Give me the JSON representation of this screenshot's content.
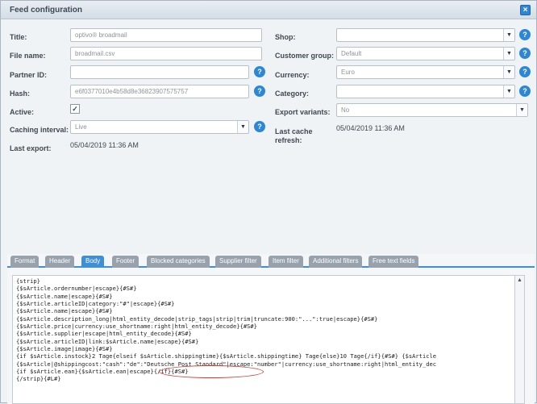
{
  "window": {
    "title": "Feed configuration",
    "close_icon": "close-icon"
  },
  "left": {
    "title": {
      "label": "Title:",
      "value": "optivo® broadmail"
    },
    "file_name": {
      "label": "File name:",
      "value": "broadmail.csv"
    },
    "partner_id": {
      "label": "Partner ID:",
      "value": ""
    },
    "hash": {
      "label": "Hash:",
      "value": "e6f0377010e4b58d8e36823907575757"
    },
    "active": {
      "label": "Active:",
      "checked": "✓"
    },
    "caching": {
      "label": "Caching interval:",
      "value": "Live"
    },
    "last_export": {
      "label": "Last export:",
      "value": "05/04/2019 11:36 AM"
    }
  },
  "right": {
    "shop": {
      "label": "Shop:",
      "value": ""
    },
    "customer_group": {
      "label": "Customer group:",
      "value": "Default"
    },
    "currency": {
      "label": "Currency:",
      "value": "Euro"
    },
    "category": {
      "label": "Category:",
      "value": ""
    },
    "export_variants": {
      "label": "Export variants:",
      "value": "No"
    },
    "last_cache": {
      "label": "Last cache refresh:",
      "value": "05/04/2019 11:36 AM"
    }
  },
  "help_glyph": "?",
  "arrow_glyph": "▼",
  "tabs": [
    "Format",
    "Header",
    "Body",
    "Footer",
    "Blocked categories",
    "Supplier filter",
    "Item filter",
    "Additional filters",
    "Free text fields"
  ],
  "active_tab": "Body",
  "editor_lines": [
    "{strip}",
    "{$sArticle.ordernumber|escape}{#S#}",
    "{$sArticle.name|escape}{#S#}",
    "{$sArticle.articleID|category:\"#\"|escape}{#S#}",
    "{$sArticle.name|escape}{#S#}",
    "{$sArticle.description_long|html_entity_decode|strip_tags|strip|trim|truncate:900:\"...\":true|escape}{#S#}",
    "{$sArticle.price|currency:use_shortname:right|html_entity_decode}{#S#}",
    "{$sArticle.supplier|escape|html_entity_decode}{#S#}",
    "{$sArticle.articleID|link:$sArticle.name|escape}{#S#}",
    "{$sArticle.image|image}{#S#}",
    "{if $sArticle.instock}2 Tage{elseif $sArticle.shippingtime}{$sArticle.shippingtime} Tage{else}10 Tage{/if}{#S#} {$sArticle",
    "{$sArticle|@shippingcost:\"cash\":\"de\":\"Deutsche Post Standard\"|escape:\"number\"|currency:use_shortname:right|html_entity_dec",
    "{if $sArticle.ean}{$sArticle.ean|escape}{/if}{#S#}",
    "{/strip}{#L#}"
  ]
}
